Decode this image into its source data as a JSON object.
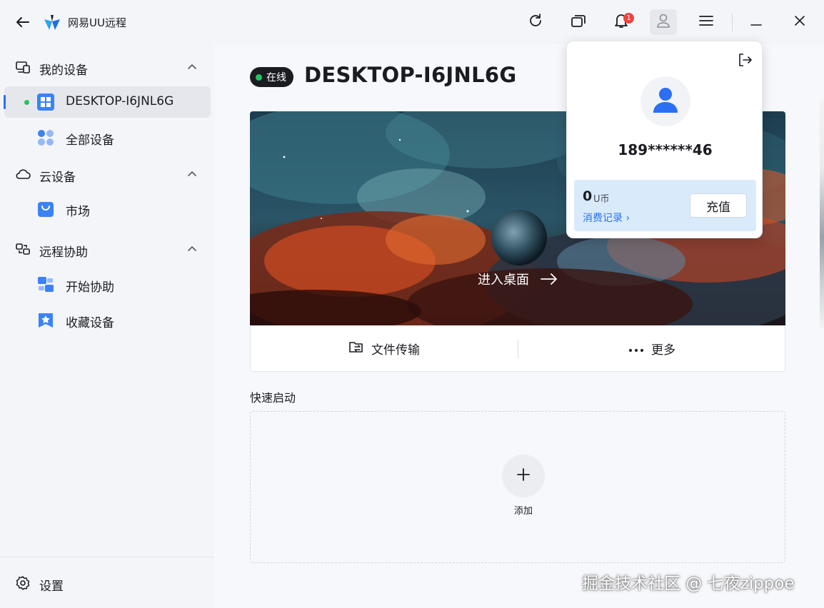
{
  "titlebar": {
    "app_title": "网易UU远程",
    "notification_count": "1",
    "icons": [
      "back-arrow-icon",
      "app-logo-icon",
      "refresh-icon",
      "windows-icon",
      "bell-icon",
      "user-icon",
      "menu-icon",
      "minimize-icon",
      "close-icon"
    ]
  },
  "sidebar": {
    "my_devices": {
      "label": "我的设备",
      "icon": "devices-icon"
    },
    "current_device": {
      "label": "DESKTOP-I6JNL6G",
      "icon": "windows-logo-icon"
    },
    "all_devices": {
      "label": "全部设备",
      "icon": "grid-dots-icon"
    },
    "cloud": {
      "label": "云设备",
      "icon": "cloud-icon"
    },
    "market": {
      "label": "市场",
      "icon": "shopping-bag-icon"
    },
    "remote_assist": {
      "label": "远程协助",
      "icon": "remote-assist-icon"
    },
    "start_assist": {
      "label": "开始协助",
      "icon": "start-assist-icon"
    },
    "favorites": {
      "label": "收藏设备",
      "icon": "star-bookmark-icon"
    },
    "settings": {
      "label": "设置",
      "icon": "gear-icon"
    }
  },
  "main": {
    "status": "在线",
    "device_name": "DESKTOP-I6JNL6G",
    "enter_desktop": "进入桌面",
    "file_transfer": "文件传输",
    "more": "更多",
    "quick_start": "快速启动",
    "add": "添加"
  },
  "popup": {
    "username": "189******46",
    "balance": "0",
    "currency": "U币",
    "spend_record": "消费记录 ›",
    "recharge": "充值"
  },
  "colors": {
    "accent": "#2b6ff5",
    "online": "#22c55e",
    "badge": "#f0423b",
    "sidebar_bg": "#f4f5f9",
    "wallet_bg": "#d9ebfb"
  },
  "watermark": "掘金技术社区 @ 七夜zippoe"
}
